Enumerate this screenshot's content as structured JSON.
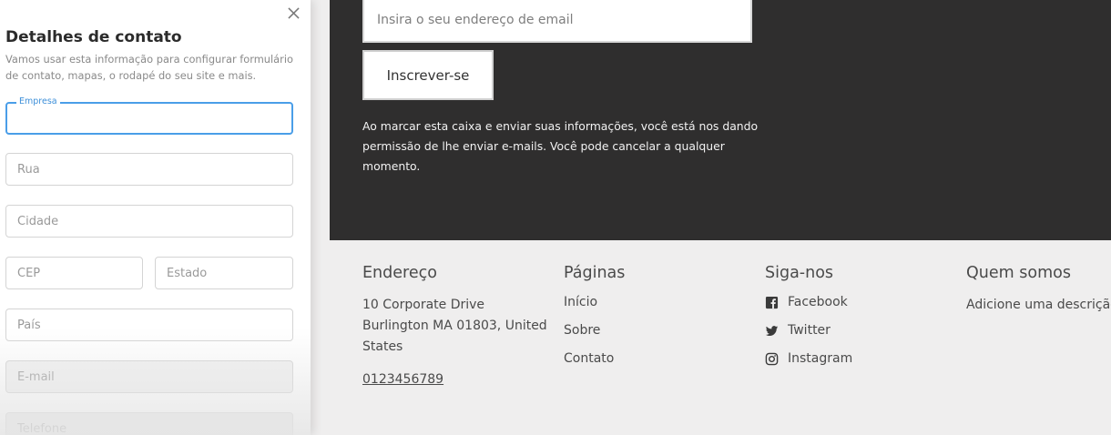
{
  "panel": {
    "title": "Detalhes de contato",
    "description": "Vamos usar esta informação para configurar formulário de contato, mapas, o rodapé do seu site e mais.",
    "fields": {
      "empresa": {
        "label": "Empresa",
        "value": ""
      },
      "rua": {
        "placeholder": "Rua"
      },
      "cidade": {
        "placeholder": "Cidade"
      },
      "cep": {
        "placeholder": "CEP"
      },
      "estado": {
        "placeholder": "Estado"
      },
      "pais": {
        "placeholder": "País"
      },
      "email": {
        "placeholder": "E-mail"
      },
      "telefone": {
        "placeholder": "Telefone"
      }
    }
  },
  "newsletter": {
    "email_placeholder": "Insira o seu endereço de email",
    "subscribe_label": "Inscrever-se",
    "consent_text": "Ao marcar esta caixa e enviar suas informações, você está nos dando permissão de lhe enviar e-mails. Você pode cancelar a qualquer momento."
  },
  "footer": {
    "address": {
      "heading": "Endereço",
      "line1": "10 Corporate Drive",
      "line2": "Burlington MA 01803, United States",
      "phone": "0123456789"
    },
    "pages": {
      "heading": "Páginas",
      "links": [
        "Início",
        "Sobre",
        "Contato"
      ]
    },
    "follow": {
      "heading": "Siga-nos",
      "items": [
        {
          "label": "Facebook",
          "icon": "facebook-icon"
        },
        {
          "label": "Twitter",
          "icon": "twitter-icon"
        },
        {
          "label": "Instagram",
          "icon": "instagram-icon"
        }
      ]
    },
    "about": {
      "heading": "Quem somos",
      "text": "Adicione uma descrição"
    }
  },
  "colors": {
    "accent": "#4a9ee8",
    "dark_section": "#2f2e2e",
    "footer_bg": "#efeeee"
  }
}
